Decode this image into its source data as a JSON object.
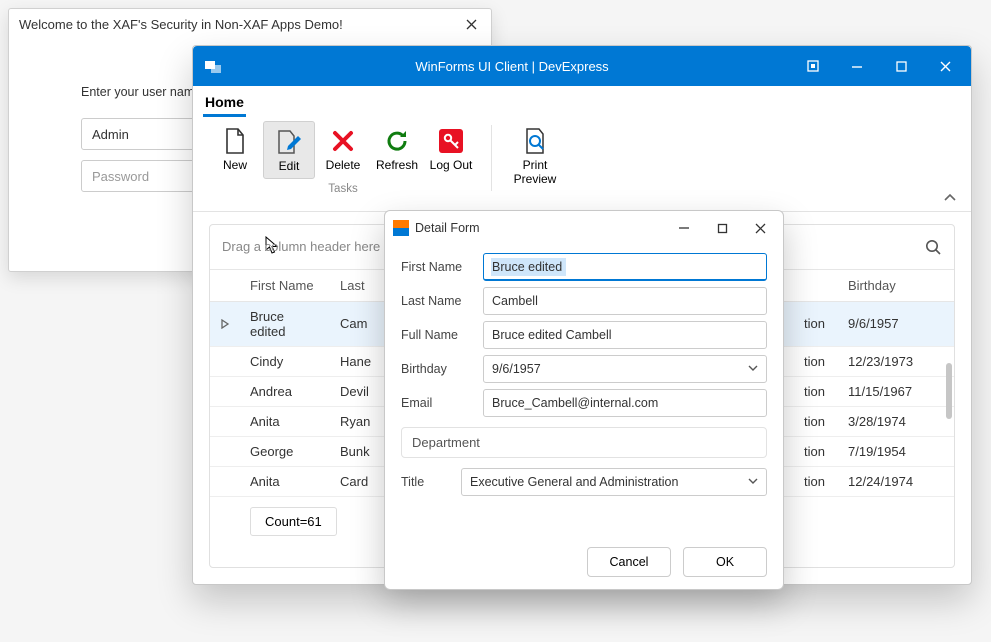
{
  "login": {
    "title": "Welcome to the XAF's Security in Non-XAF Apps Demo!",
    "prompt": "Enter your user name",
    "username_value": "Admin",
    "password_placeholder": "Password"
  },
  "app": {
    "title": "WinForms UI Client | DevExpress",
    "tab": "Home",
    "ribbon": {
      "tasks_group": "Tasks",
      "new": "New",
      "edit": "Edit",
      "delete": "Delete",
      "refresh": "Refresh",
      "logout": "Log Out",
      "print_preview": "Print\nPreview"
    },
    "grid": {
      "group_hint": "Drag a column header here to gr",
      "columns": {
        "first": "First Name",
        "last": "Last",
        "dept": "",
        "birthday": "Birthday"
      },
      "rows": [
        {
          "first": "Bruce edited",
          "last": "Cam",
          "dept": "tion",
          "birthday": "9/6/1957",
          "selected": true
        },
        {
          "first": "Cindy",
          "last": "Hane",
          "dept": "tion",
          "birthday": "12/23/1973"
        },
        {
          "first": "Andrea",
          "last": "Devil",
          "dept": "tion",
          "birthday": "11/15/1967"
        },
        {
          "first": "Anita",
          "last": "Ryan",
          "dept": "tion",
          "birthday": "3/28/1974"
        },
        {
          "first": "George",
          "last": "Bunk",
          "dept": "tion",
          "birthday": "7/19/1954"
        },
        {
          "first": "Anita",
          "last": "Card",
          "dept": "tion",
          "birthday": "12/24/1974"
        }
      ],
      "count_label": "Count=61"
    }
  },
  "detail": {
    "title": "Detail Form",
    "labels": {
      "first": "First Name",
      "last": "Last Name",
      "full": "Full Name",
      "birthday": "Birthday",
      "email": "Email",
      "dept": "Department",
      "title": "Title"
    },
    "values": {
      "first": "Bruce edited",
      "last": "Cambell",
      "full": "Bruce edited Cambell",
      "birthday": "9/6/1957",
      "email": "Bruce_Cambell@internal.com",
      "title_select": "Executive General and Administration"
    },
    "buttons": {
      "cancel": "Cancel",
      "ok": "OK"
    }
  }
}
